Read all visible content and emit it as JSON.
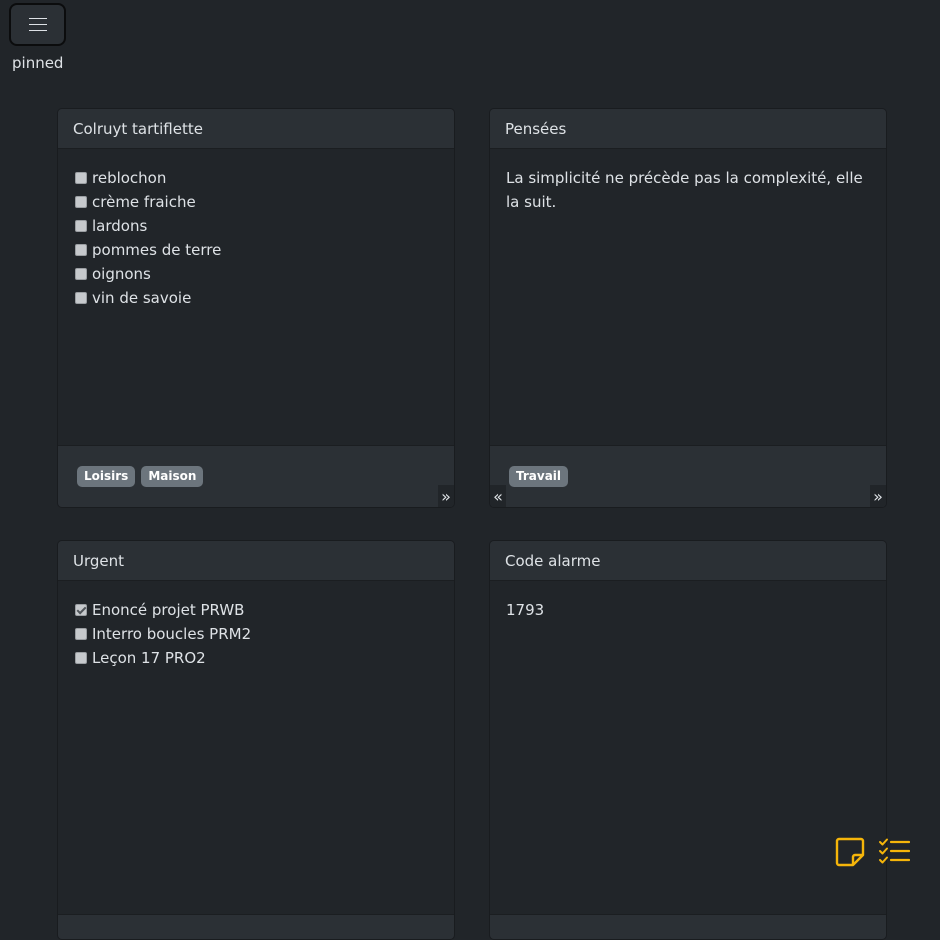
{
  "header": {
    "menu_icon": "hamburger-icon",
    "section_label": "pinned"
  },
  "cards": [
    {
      "title": "Colruyt tartiflette",
      "type": "checklist",
      "items": [
        {
          "label": "reblochon",
          "checked": false
        },
        {
          "label": "crème fraiche",
          "checked": false
        },
        {
          "label": "lardons",
          "checked": false
        },
        {
          "label": "pommes de terre",
          "checked": false
        },
        {
          "label": "oignons",
          "checked": false
        },
        {
          "label": "vin de savoie",
          "checked": false
        }
      ],
      "tags": [
        "Loisirs",
        "Maison"
      ],
      "has_prev": false,
      "has_next": true
    },
    {
      "title": "Pensées",
      "type": "text",
      "text": "La simplicité ne précède pas la complexité, elle la suit.",
      "tags": [
        "Travail"
      ],
      "has_prev": true,
      "has_next": true
    },
    {
      "title": "Urgent",
      "type": "checklist",
      "items": [
        {
          "label": "Enoncé projet PRWB",
          "checked": true
        },
        {
          "label": "Interro boucles PRM2",
          "checked": false
        },
        {
          "label": "Leçon 17 PRO2",
          "checked": false
        }
      ]
    },
    {
      "title": "Code alarme",
      "type": "text",
      "text": "1793"
    }
  ],
  "actions": {
    "new_note_icon": "sticky-note-icon",
    "new_checklist_icon": "checklist-icon",
    "accent_color": "#f5b50a"
  },
  "colors": {
    "background": "#212529",
    "card_header": "#2b3035",
    "tag_bg": "#6c757d"
  }
}
